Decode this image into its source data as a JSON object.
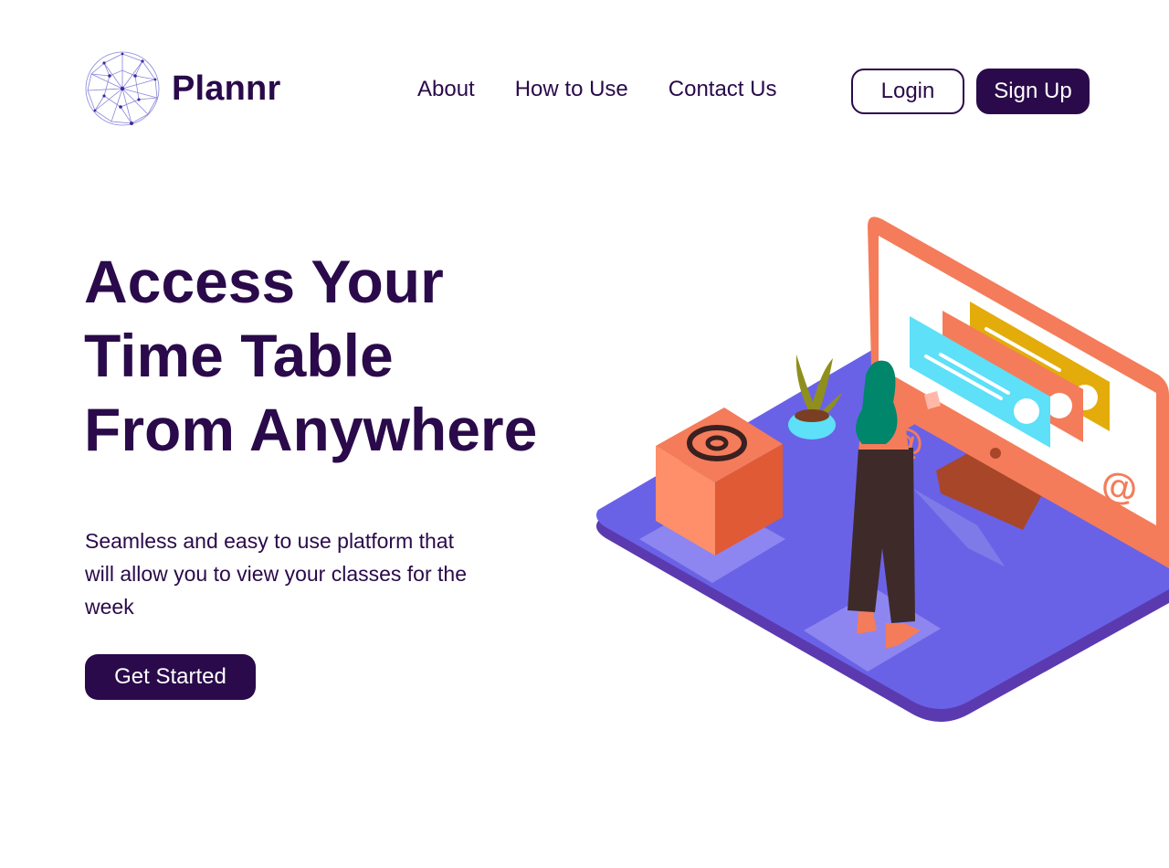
{
  "brand": {
    "name": "Plannr",
    "logo_icon": "globe-network-icon"
  },
  "nav": {
    "items": [
      {
        "label": "About"
      },
      {
        "label": "How to Use"
      },
      {
        "label": "Contact Us"
      }
    ]
  },
  "auth": {
    "login_label": "Login",
    "signup_label": "Sign Up"
  },
  "hero": {
    "title_lines": [
      "Access Your",
      "Time Table",
      "From Anywhere"
    ],
    "subtitle": "Seamless and easy to use platform that will allow you to view your classes for the week",
    "cta_label": "Get Started"
  },
  "colors": {
    "primary": "#2a0a4a",
    "platform": "#6a62e6",
    "accent_orange": "#f47c5a",
    "accent_cyan": "#5de0f8",
    "accent_yellow": "#e3ac0a",
    "hair_green": "#00866a"
  }
}
